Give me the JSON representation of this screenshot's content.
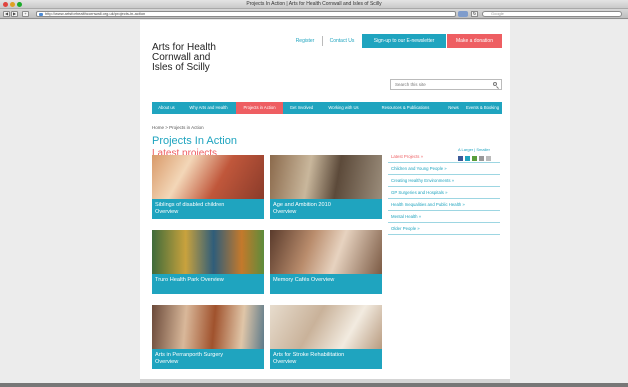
{
  "window": {
    "title": "Projects In Action | Arts for Health Cornwall and Isles of Scilly",
    "url": "http://www.artsforhealthcornwall.org.uk/projects-in-action",
    "search_placeholder": "Google"
  },
  "site": {
    "logo": [
      "Arts for Health",
      "Cornwall and",
      "Isles of Scilly"
    ],
    "top_links": {
      "register": "Register",
      "contact": "Contact Us",
      "signup": "Sign-up to our E-newsletter",
      "donation": "Make a donation"
    },
    "search_placeholder": "Search this site",
    "nav": [
      "About us",
      "Why Arts and Health",
      "Projects in Action",
      "Get Involved",
      "Working with Us",
      "Resources & Publications",
      "News",
      "Events & Booking"
    ],
    "breadcrumb": "Home > Projects in Action",
    "heading": "Projects In Action",
    "subheading": "Latest projects",
    "text_size": "A Larger | Smaller",
    "cards": [
      {
        "line1": "Siblings of disabled children",
        "line2": "Overview"
      },
      {
        "line1": "Age and Ambition 2010",
        "line2": "Overview"
      },
      {
        "line1": "Truro Health Park Overview",
        "line2": ""
      },
      {
        "line1": "Memory Cafés Overview",
        "line2": ""
      },
      {
        "line1": "Arts in Perranporth Surgery",
        "line2": "Overview"
      },
      {
        "line1": "Arts for Stroke Rehabilitation",
        "line2": "Overview"
      }
    ],
    "sidebar": [
      "Latest Projects »",
      "Children and Young People »",
      "Creating Healthy Environments »",
      "GP Surgeries and Hospitals »",
      "Health Inequalities and Public Health »",
      "Mental Health »",
      "Older People »"
    ]
  },
  "colors": {
    "accent": "#1fa4bf",
    "pink": "#ee5e62"
  }
}
